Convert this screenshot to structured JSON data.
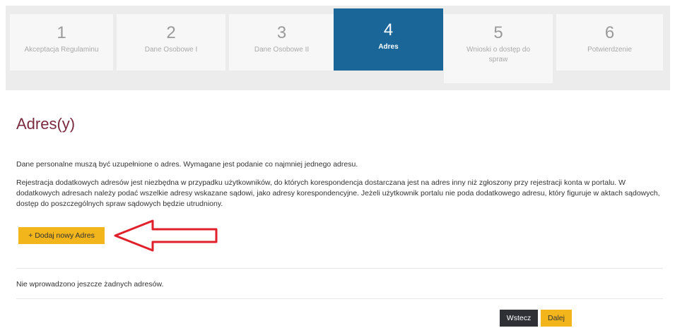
{
  "steps": [
    {
      "number": "1",
      "label": "Akceptacja Regulaminu"
    },
    {
      "number": "2",
      "label": "Dane Osobowe I"
    },
    {
      "number": "3",
      "label": "Dane Osobowe II"
    },
    {
      "number": "4",
      "label": "Adres"
    },
    {
      "number": "5",
      "label": "Wnioski o dostęp do spraw"
    },
    {
      "number": "6",
      "label": "Potwierdzenie"
    }
  ],
  "active_step": "4",
  "page_title": "Adres(y)",
  "intro_text": "Dane personalne muszą być uzupełnione o adres. Wymagane jest podanie co najmniej jednego adresu.",
  "info_text": "Rejestracja dodatkowych adresów jest niezbędna w przypadku użytkowników, do których korespondencja dostarczana jest na adres inny niż zgłoszony przy rejestracji konta w portalu. W dodatkowych adresach należy podać wszelkie adresy wskazane sądowi, jako adresy korespondencyjne. Jeżeli użytkownik portalu nie poda dodatkowego adresu, który figuruje w aktach sądowych, dostęp do poszczególnych spraw sądowych będzie utrudniony.",
  "add_button_label": "+ Dodaj nowy Adres",
  "empty_message": "Nie wprowadzono jeszcze żadnych adresów.",
  "back_button_label": "Wstecz",
  "next_button_label": "Dalej",
  "colors": {
    "active_step": "#1a6699",
    "title": "#7a2a3e",
    "primary_button": "#f2b51c",
    "dark_button": "#2e3036",
    "annotation_arrow": "#e0202a"
  }
}
